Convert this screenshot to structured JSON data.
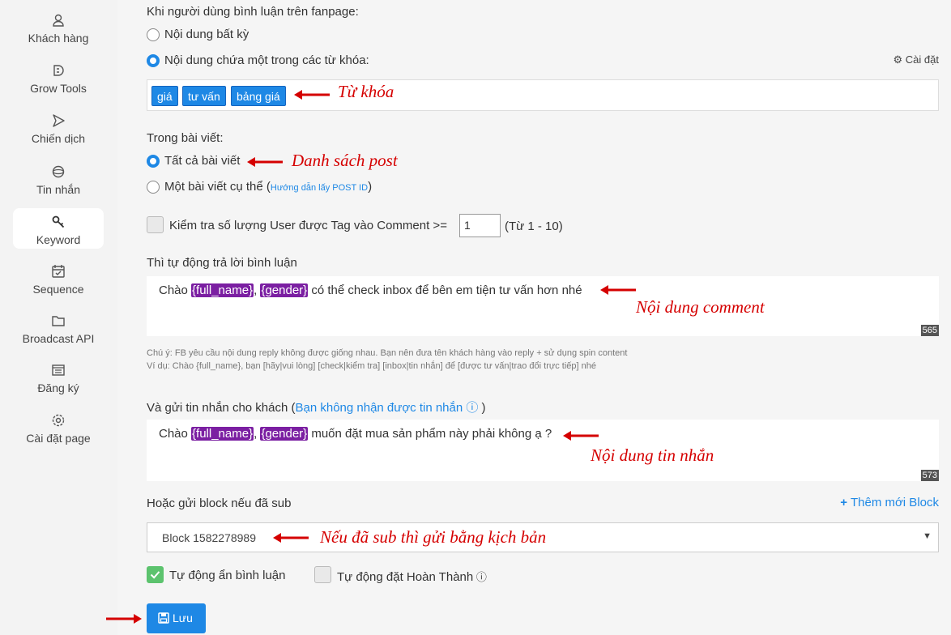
{
  "sidebar": {
    "items": [
      {
        "label": "Khách hàng",
        "icon": "user-icon"
      },
      {
        "label": "Grow Tools",
        "icon": "grow-tools-icon"
      },
      {
        "label": "Chiến dịch",
        "icon": "send-icon"
      },
      {
        "label": "Tin nhắn",
        "icon": "chat-icon"
      },
      {
        "label": "Keyword",
        "icon": "key-icon",
        "active": true
      },
      {
        "label": "Sequence",
        "icon": "calendar-check-icon"
      },
      {
        "label": "Broadcast API",
        "icon": "folder-icon"
      },
      {
        "label": "Đăng ký",
        "icon": "list-icon"
      },
      {
        "label": "Cài đặt page",
        "icon": "gear-icon"
      }
    ]
  },
  "form": {
    "trigger_label": "Khi người dùng bình luận trên fanpage:",
    "opt_any": "Nội dung bất kỳ",
    "opt_keyword": "Nội dung chứa một trong các từ khóa:",
    "settings_link": "Cài đặt",
    "keywords": [
      "giá",
      "tư vấn",
      "bảng giá"
    ],
    "post_label": "Trong bài viết:",
    "opt_all_posts": "Tất cả bài viết",
    "opt_specific_post": "Một bài viết cụ thể (",
    "post_id_help": "Hướng dẫn lấy POST ID",
    "post_id_close": ")",
    "tag_check_label": "Kiểm tra số lượng User được Tag vào Comment >=",
    "tag_count_value": "1",
    "tag_range": "(Từ 1 - 10)",
    "reply_label": "Thì tự động trả lời bình luận",
    "reply": {
      "prefix": "Chào ",
      "var1": "{full_name}",
      "sep": ", ",
      "var2": "{gender}",
      "suffix": " có thể check inbox để bên em tiện tư vấn hơn nhé",
      "count": "565"
    },
    "note1": "Chú ý: FB yêu cầu nội dung reply không được giống nhau. Bạn nên đưa tên khách hàng vào reply + sử dụng spin content",
    "note2": "Ví dụ: Chào {full_name}, bạn [hãy|vui lòng] [check|kiểm tra] [inbox|tin nhắn] để [được tư vấn|trao đổi trực tiếp] nhé",
    "message_label": "Và gửi tin nhắn cho khách (",
    "message_help": "Bạn không nhận được tin nhắn",
    "message_close": ")",
    "message": {
      "prefix": "Chào ",
      "var1": "{full_name}",
      "sep": ", ",
      "var2": "{gender}",
      "suffix": " muốn đặt mua sản phẩm này phải không ạ ?",
      "count": "573"
    },
    "block_label": "Hoặc gửi block nếu đã sub",
    "add_block": "Thêm mới Block",
    "block_selected": "Block 1582278989",
    "auto_hide_label": "Tự động ẩn bình luận",
    "auto_complete_label": "Tự động đặt Hoàn Thành",
    "save_label": "Lưu"
  },
  "annotations": {
    "keyword": "Từ khóa",
    "post_list": "Danh sách post",
    "comment_content": "Nội dung comment",
    "message_content": "Nội dung tin nhắn",
    "block_note": "Nếu đã sub thì gửi bằng kịch bản"
  },
  "colors": {
    "accent": "#1e88e5",
    "annotation": "#d50000",
    "variable": "#7b1fa2",
    "check_on": "#5cc36e"
  }
}
